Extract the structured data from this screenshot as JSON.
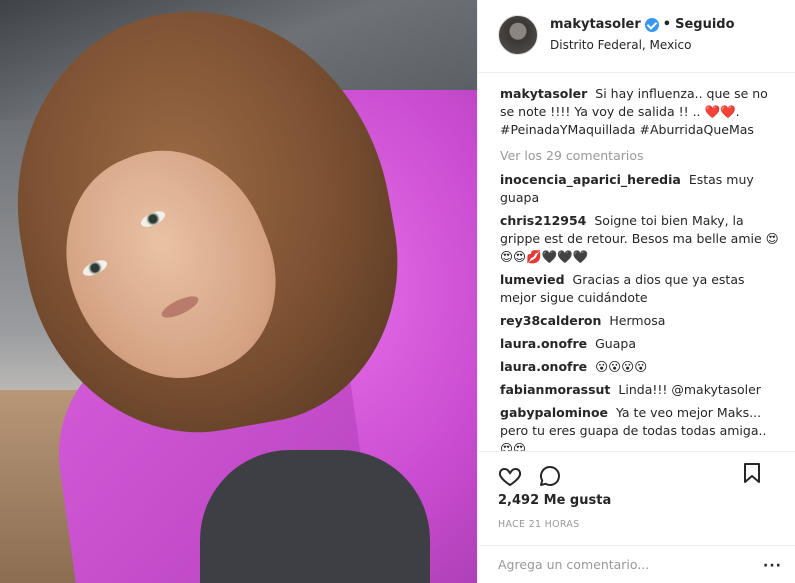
{
  "header": {
    "username": "makytasoler",
    "separator": "•",
    "follow_status": "Seguido",
    "location": "Distrito Federal, Mexico"
  },
  "caption": {
    "author": "makytasoler",
    "text": "Si hay influenza.. que se no se note !!!! Ya voy de salida !! .. ❤️❤️. #PeinadaYMaquillada #AburridaQueMas"
  },
  "view_all_comments": "Ver los 29 comentarios",
  "comments": [
    {
      "author": "inocencia_aparici_heredia",
      "text": "Estas muy guapa"
    },
    {
      "author": "chris212954",
      "text": "Soigne toi bien Maky, la grippe est de retour. Besos ma belle amie 😍😍😍💋🖤🖤🖤"
    },
    {
      "author": "lumevied",
      "text": "Gracias a dios que ya estas mejor sigue cuidándote"
    },
    {
      "author": "rey38calderon",
      "text": "Hermosa"
    },
    {
      "author": "laura.onofre",
      "text": "Guapa"
    },
    {
      "author": "laura.onofre",
      "text": "😮😮😮😮"
    },
    {
      "author": "fabianmorassut",
      "text": "Linda!!! @makytasoler"
    },
    {
      "author": "gabypalominoe",
      "text": "Ya te veo mejor Maks... pero tu eres guapa de todas todas amiga.. 😍😍"
    }
  ],
  "likes": "2,492 Me gusta",
  "timestamp": "HACE 21 HORAS",
  "add_comment": {
    "placeholder": "Agrega un comentario..."
  },
  "icons": {
    "like": "heart-outline-icon",
    "comment": "speech-bubble-icon",
    "save": "bookmark-icon",
    "verified": "verified-badge-icon",
    "more": "more-options-icon"
  },
  "colors": {
    "verified_blue": "#3897f0",
    "muted_text": "#999999",
    "text": "#262626",
    "divider": "#efefef"
  }
}
